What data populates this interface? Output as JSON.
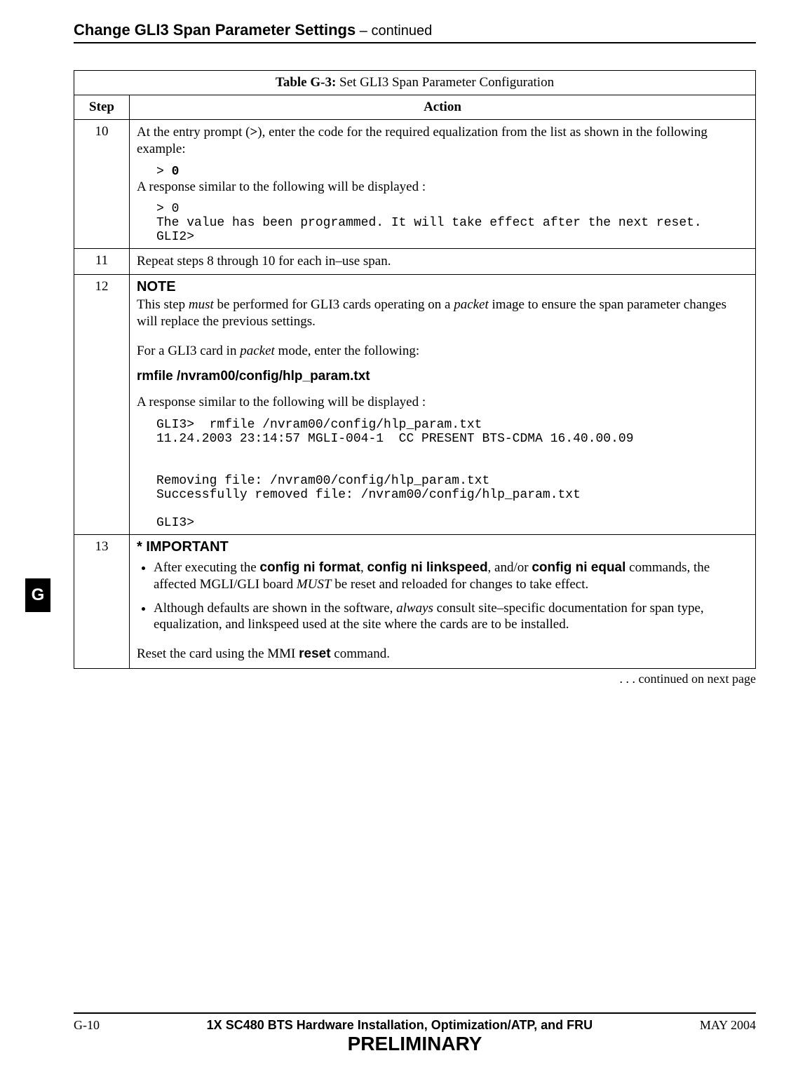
{
  "header": {
    "title": "Change GLI3 Span Parameter Settings",
    "continued": "  – continued"
  },
  "sideTab": "G",
  "table": {
    "caption_label": "Table G-3:",
    "caption_text": " Set GLI3 Span Parameter Configuration",
    "col_step": "Step",
    "col_action": "Action",
    "rows": {
      "r10": {
        "num": "10",
        "p1a": "At the entry prompt (",
        "p1b": "), enter the code for the required equalization from the list as shown in the following example:",
        "gt": ">",
        "cmd_prefix": "> ",
        "cmd_bold": "0",
        "p2": "A response similar to the following will be displayed :",
        "out": "> 0\nThe value has been programmed. It will take effect after the next reset.\nGLI2>"
      },
      "r11": {
        "num": "11",
        "p1": "Repeat steps 8 through 10 for each in–use span."
      },
      "r12": {
        "num": "12",
        "note": "NOTE",
        "p1a": "This step ",
        "p1_must": "must",
        "p1b": " be performed for GLI3 cards operating on a ",
        "p1_packet": "packet",
        "p1c": " image to ensure the span parameter changes will replace the previous settings.",
        "p2a": "For a GLI3 card in ",
        "p2_packet": "packet",
        "p2b": " mode, enter the following:",
        "cmd": "rmfile  /nvram00/config/hlp_param.txt",
        "p3": "A response similar to the following will be displayed :",
        "out": "GLI3>  rmfile /nvram00/config/hlp_param.txt\n11.24.2003 23:14:57 MGLI-004-1  CC PRESENT BTS-CDMA 16.40.00.09\n\n\nRemoving file: /nvram00/config/hlp_param.txt\nSuccessfully removed file: /nvram00/config/hlp_param.txt\n\nGLI3>"
      },
      "r13": {
        "num": "13",
        "imp": "* IMPORTANT",
        "b1a": "After executing the ",
        "b1_cmd1": "config  ni  format",
        "b1b": ", ",
        "b1_cmd2": "config  ni  linkspeed",
        "b1c": ", and/or ",
        "b1_cmd3": "config  ni  equal",
        "b1d": " commands, the affected MGLI/GLI board ",
        "b1_must": "MUST",
        "b1e": " be reset and reloaded for changes to take effect.",
        "b2a": "Although defaults are shown in the software, ",
        "b2_always": "always",
        "b2b": " consult site–specific documentation for span type, equalization, and linkspeed used at the site where the cards are to be installed.",
        "p_last_a": "Reset the card using the MMI ",
        "p_last_cmd": "reset",
        "p_last_b": " command."
      }
    }
  },
  "continued_note": ". . . continued on next page",
  "footer": {
    "page": "G-10",
    "doc": "1X SC480 BTS Hardware Installation, Optimization/ATP, and FRU",
    "date": "MAY 2004",
    "prelim": "PRELIMINARY"
  }
}
